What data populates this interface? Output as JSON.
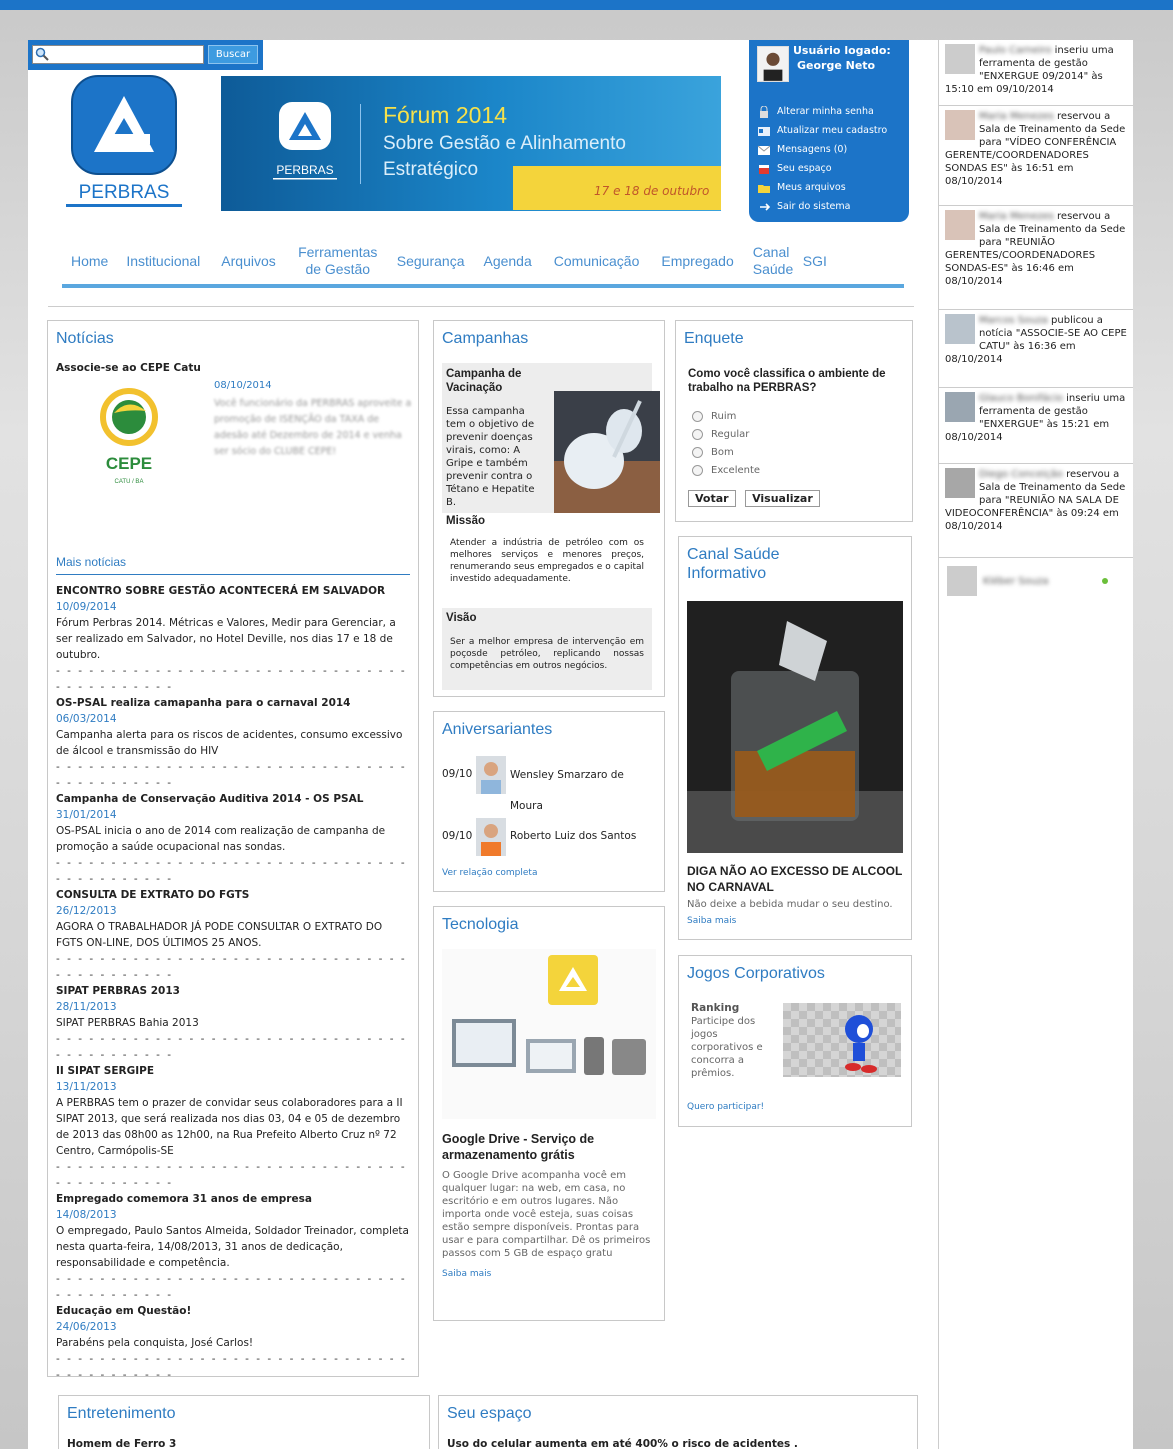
{
  "search": {
    "placeholder": "",
    "button": "Buscar"
  },
  "brand": {
    "name": "PERBRAS"
  },
  "banner": {
    "title": "Fórum 2014",
    "subtitle": "Sobre Gestão e Alinhamento Estratégico",
    "date": "17 e 18 de outubro",
    "logo_text": "PERBRAS"
  },
  "user": {
    "label": "Usuário logado:",
    "name": "George Neto",
    "links": [
      {
        "label": "Alterar minha senha",
        "icon": "lock-icon"
      },
      {
        "label": "Atualizar meu cadastro",
        "icon": "id-card-icon"
      },
      {
        "label": "Mensagens (0)",
        "icon": "envelope-icon"
      },
      {
        "label": "Seu espaço",
        "icon": "cube-icon"
      },
      {
        "label": "Meus arquivos",
        "icon": "folder-icon"
      },
      {
        "label": "Sair do sistema",
        "icon": "exit-icon"
      }
    ]
  },
  "nav": [
    "Home",
    "Institucional",
    "Arquivos",
    "Ferramentas de Gestão",
    "Segurança",
    "Agenda",
    "Comunicação",
    "Empregado",
    "Canal Saúde",
    "SGI"
  ],
  "noticias": {
    "title": "Notícias",
    "featured": {
      "title": "Associe-se ao CEPE Catu",
      "date": "08/10/2014",
      "text": "Você funcionário da PERBRAS aproveite a promoção de ISENÇÃO da TAXA de adesão até Dezembro de 2014 e venha ser sócio do CLUBE CEPE!",
      "logo_text": "CEPE",
      "logo_sub": "CATU / BA"
    },
    "more_title": "Mais notícias",
    "separator": "- - - - - - - - - - - - - - - - - - - - - - - - - - - - - - - - - - - - - - - - - - -",
    "items": [
      {
        "title": "ENCONTRO SOBRE GESTÃO ACONTECERÁ EM SALVADOR",
        "date": "10/09/2014",
        "text": "Fórum Perbras 2014. Métricas e Valores, Medir para Gerenciar, a ser realizado em Salvador, no Hotel Deville, nos dias 17 e 18 de outubro."
      },
      {
        "title": "OS-PSAL realiza camapanha para o carnaval 2014",
        "date": "06/03/2014",
        "text": "Campanha alerta para os riscos de acidentes, consumo excessivo de álcool e transmissão do HIV"
      },
      {
        "title": "Campanha de Conservação Auditiva 2014 - OS PSAL",
        "date": "31/01/2014",
        "text": "OS-PSAL inicia o ano de 2014 com realização de campanha de promoção a saúde ocupacional nas sondas."
      },
      {
        "title": "CONSULTA DE EXTRATO DO FGTS",
        "date": "26/12/2013",
        "text": "AGORA O TRABALHADOR JÁ PODE CONSULTAR O EXTRATO DO FGTS ON-LINE, DOS ÚLTIMOS 25 ANOS."
      },
      {
        "title": "SIPAT PERBRAS 2013",
        "date": "28/11/2013",
        "text": "SIPAT PERBRAS Bahia 2013"
      },
      {
        "title": "II SIPAT SERGIPE",
        "date": "13/11/2013",
        "text": "A PERBRAS tem o prazer de convidar seus colaboradores para a II SIPAT 2013, que será realizada nos dias 03, 04 e 05 de dezembro de 2013 das 08h00 as 12h00, na Rua Prefeito Alberto Cruz nº 72 Centro, Carmópolis-SE"
      },
      {
        "title": "Empregado comemora 31 anos de empresa",
        "date": "14/08/2013",
        "text": "O empregado, Paulo Santos Almeida, Soldador Treinador, completa nesta quarta-feira, 14/08/2013, 31 anos de dedicação, responsabilidade e competência."
      },
      {
        "title": "Educação em Questão!",
        "date": "24/06/2013",
        "text": "Parabéns pela conquista, José Carlos!"
      }
    ]
  },
  "campanhas": {
    "title": "Campanhas",
    "campaign_title": "Campanha de Vacinação",
    "campaign_text": "Essa campanha tem o objetivo de prevenir doenças virais, como: A Gripe e também prevenir contra o Tétano e Hepatite B.",
    "missao_title": "Missão",
    "missao_text": "Atender a indústria de petróleo com os melhores serviços e menores preços, renumerando seus empregados e o capital investido adequadamente.",
    "visao_title": "Visão",
    "visao_text": "Ser a melhor empresa de intervenção em poçosde petróleo, replicando nossas competências em outros negócios."
  },
  "aniversariantes": {
    "title": "Aniversariantes",
    "people": [
      {
        "date": "09/10",
        "name": "Wensley Smarzaro de Moura"
      },
      {
        "date": "09/10",
        "name": "Roberto Luiz dos Santos"
      }
    ],
    "link": "Ver relação completa"
  },
  "tecnologia": {
    "title": "Tecnologia",
    "article_title": "Google Drive - Serviço de armazenamento grátis",
    "article_text": "O Google Drive acompanha você em qualquer lugar: na web, em casa, no escritório e em outros lugares. Não importa onde você esteja, suas coisas estão sempre disponíveis. Prontas para usar e para compartilhar. Dê os primeiros passos com 5 GB de espaço gratu",
    "link": "Saiba mais"
  },
  "enquete": {
    "title": "Enquete",
    "question": "Como você classifica o ambiente de trabalho na PERBRAS?",
    "options": [
      "Ruim",
      "Regular",
      "Bom",
      "Excelente"
    ],
    "vote": "Votar",
    "view": "Visualizar"
  },
  "canal_saude": {
    "title": "Canal Saúde Informativo",
    "article_title": "DIGA NÃO AO EXCESSO DE ALCOOL NO CARNAVAL",
    "article_text": "Não deixe a bebida mudar o seu destino.",
    "link": "Saiba mais"
  },
  "jogos": {
    "title": "Jogos Corporativos",
    "heading": "Ranking",
    "text": "Participe dos jogos corporativos e concorra a prêmios.",
    "link": "Quero participar!"
  },
  "entretenimento": {
    "title": "Entretenimento",
    "item": "Homem de Ferro 3"
  },
  "seu_espaco": {
    "title": "Seu espaço",
    "item": "Uso do celular aumenta em até 400% o risco de acidentes ."
  },
  "sidebar": {
    "activities": [
      {
        "name": "Paulo Carneiro",
        "text": "inseriu uma ferramenta de gestão \"ENXERGUE 09/2014\" às 15:10 em 09/10/2014"
      },
      {
        "name": "Maria Menezes",
        "text": "reservou a Sala de Treinamento da Sede para \"VÍDEO CONFERÊNCIA GERENTE/COORDENADORES SONDAS ES\" às 16:51 em 08/10/2014"
      },
      {
        "name": "Maria Menezes",
        "text": "reservou a Sala de Treinamento da Sede para \"REUNIÃO GERENTES/COORDENADORES SONDAS-ES\" às 16:46 em 08/10/2014"
      },
      {
        "name": "Marcos Souza",
        "text": "publicou a notícia \"ASSOCIE-SE AO CEPE CATU\" às 16:36 em 08/10/2014"
      },
      {
        "name": "Glauco Bonifácio",
        "text": "inseriu uma ferramenta de gestão \"ENXERGUE\" às 15:21 em 08/10/2014"
      },
      {
        "name": "Diego Conceição",
        "text": "reservou a Sala de Treinamento da Sede para \"REUNIÃO NA SALA DE VIDEOCONFERÊNCIA\" às 09:24 em 08/10/2014"
      }
    ],
    "online_user": "Kléber Souza"
  },
  "colors": {
    "primary": "#1c74c8",
    "link": "#2f7cc2",
    "nav": "#4a8fcf",
    "banner_accent": "#f4d43b"
  }
}
